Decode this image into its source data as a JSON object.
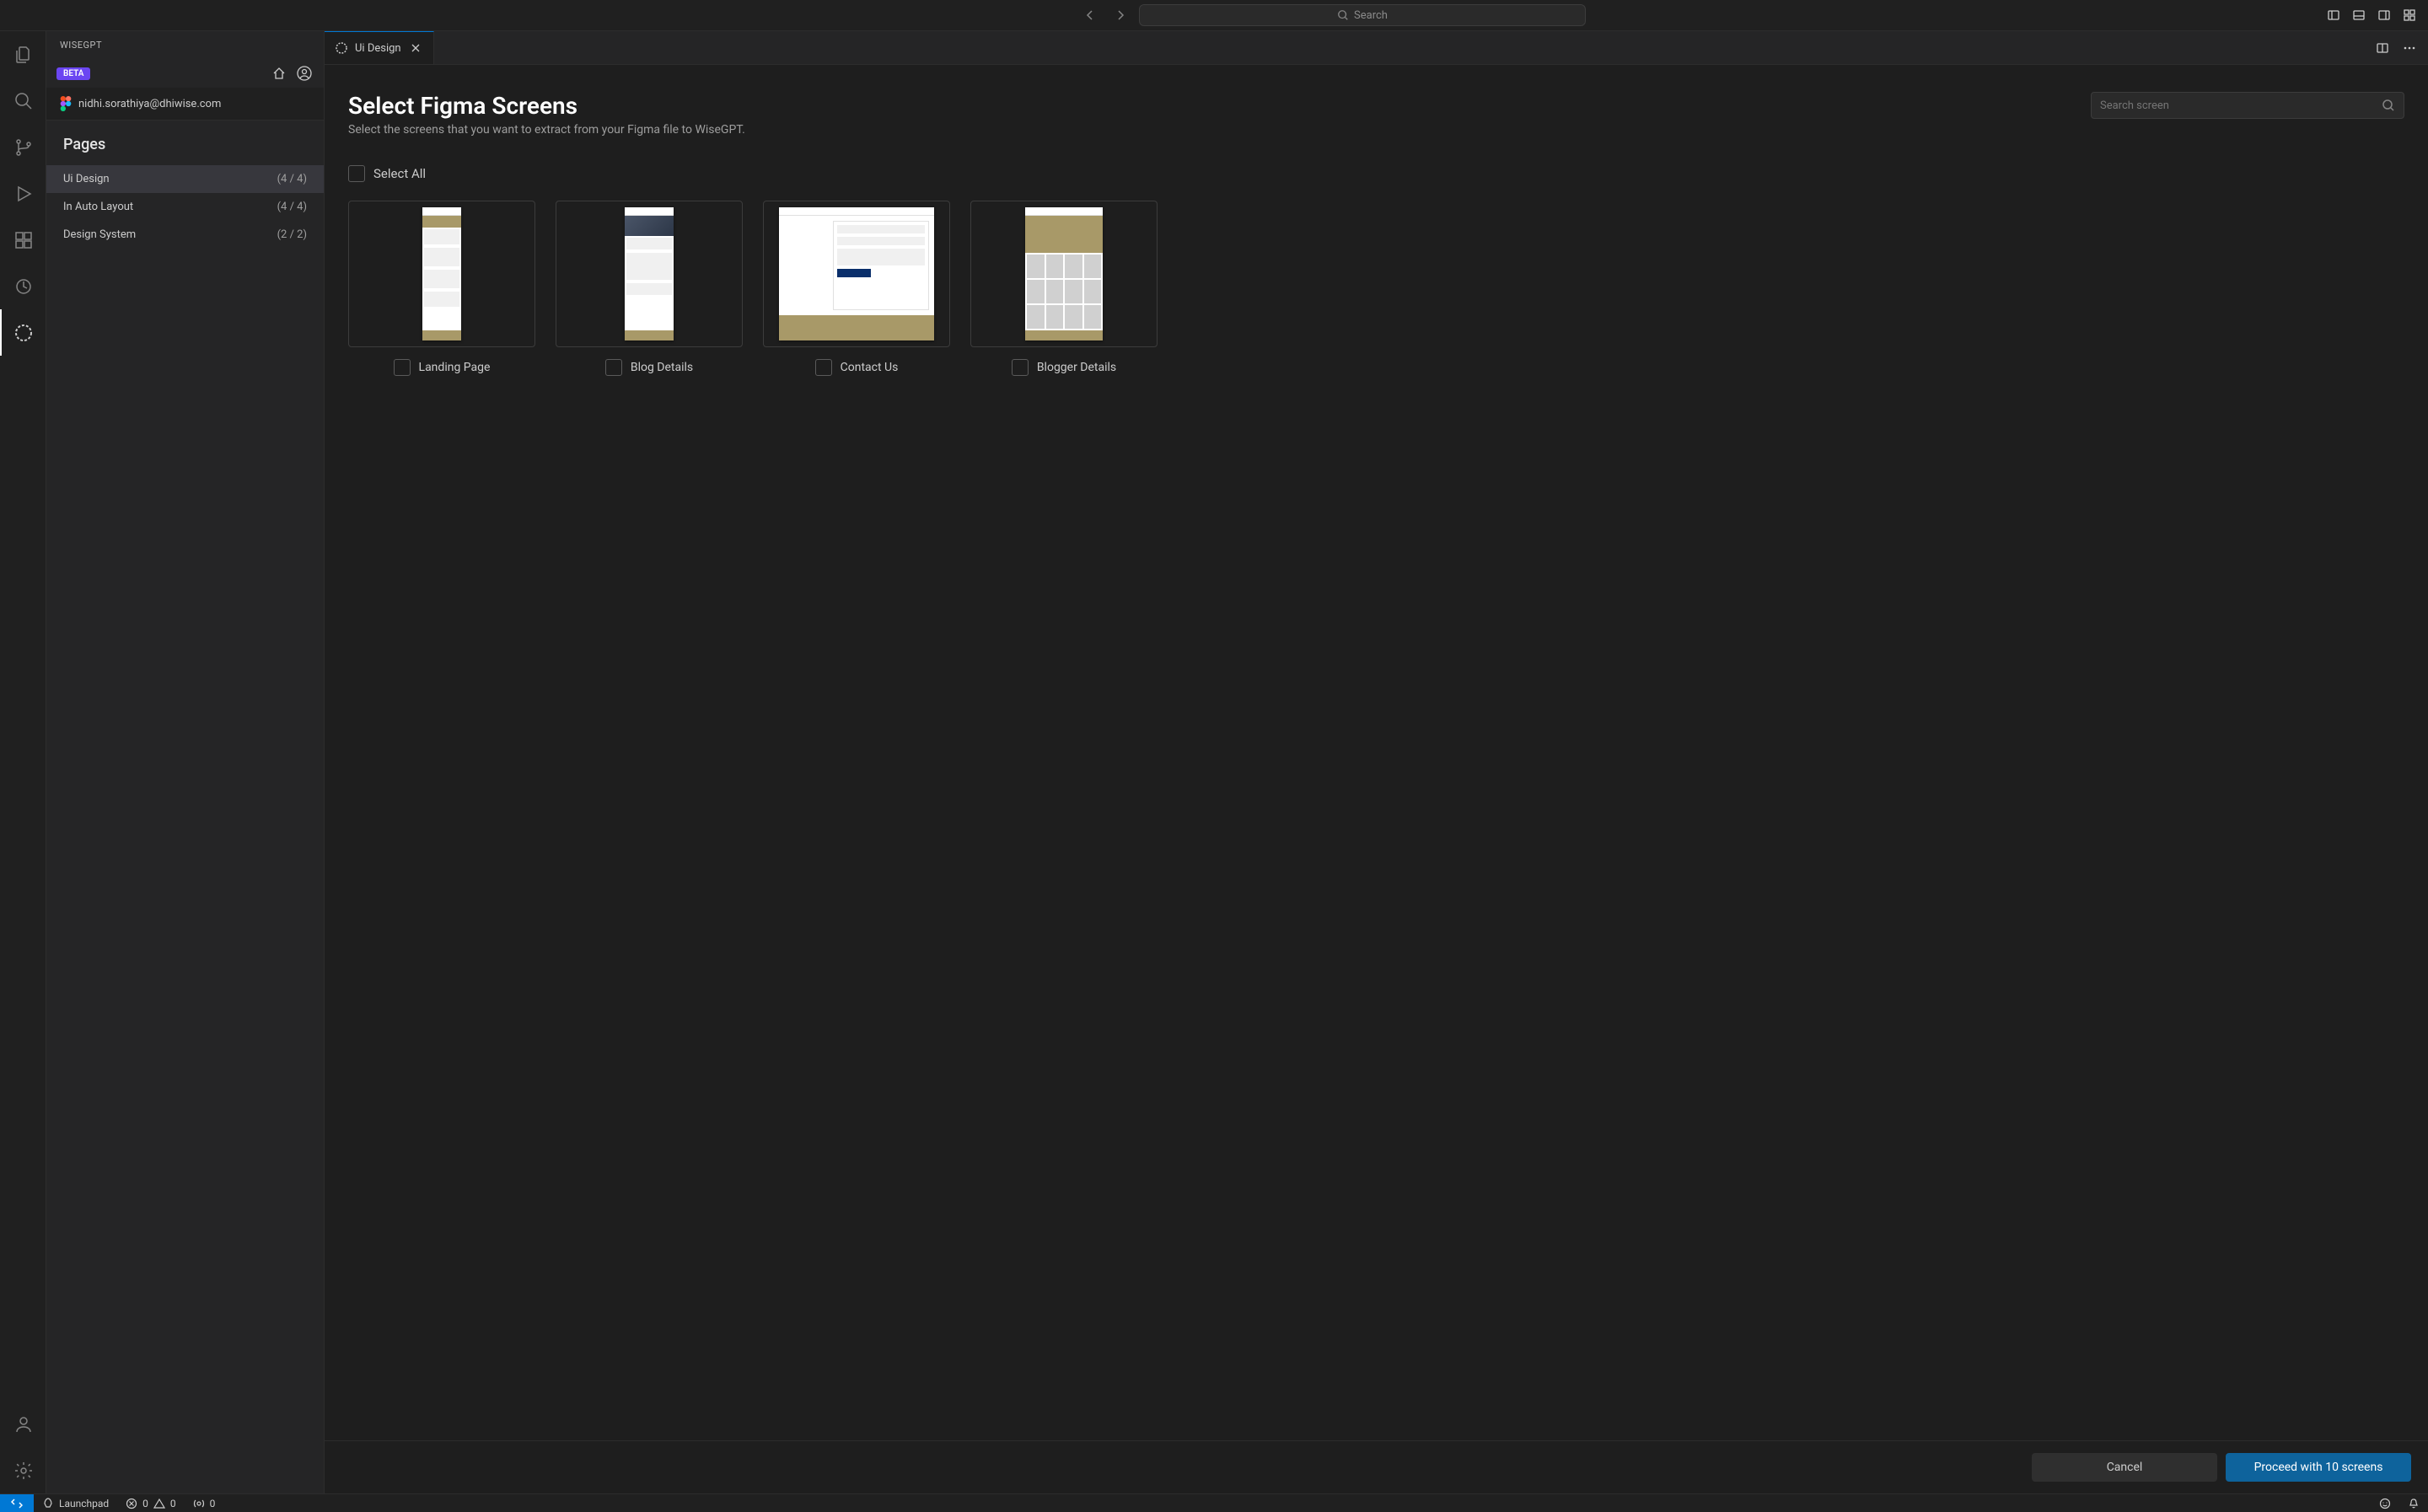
{
  "titlebar": {
    "search_placeholder": "Search"
  },
  "sidebar": {
    "title": "WISEGPT",
    "badge": "BETA",
    "account_email": "nidhi.sorathiya@dhiwise.com",
    "pages_label": "Pages",
    "pages": [
      {
        "name": "Ui Design",
        "count": "(4 / 4)",
        "active": true
      },
      {
        "name": "In Auto Layout",
        "count": "(4 / 4)",
        "active": false
      },
      {
        "name": "Design System",
        "count": "(2 / 2)",
        "active": false
      }
    ]
  },
  "tab": {
    "label": "Ui Design"
  },
  "content": {
    "heading": "Select Figma Screens",
    "subheading": "Select the screens that you want to extract from your Figma file to WiseGPT.",
    "search_placeholder": "Search screen",
    "select_all_label": "Select All",
    "screens": [
      {
        "label": "Landing Page"
      },
      {
        "label": "Blog Details"
      },
      {
        "label": "Contact Us"
      },
      {
        "label": "Blogger Details"
      }
    ]
  },
  "footer": {
    "cancel": "Cancel",
    "proceed": "Proceed with 10 screens"
  },
  "statusbar": {
    "launchpad": "Launchpad",
    "errors": "0",
    "warnings": "0",
    "ports": "0"
  }
}
